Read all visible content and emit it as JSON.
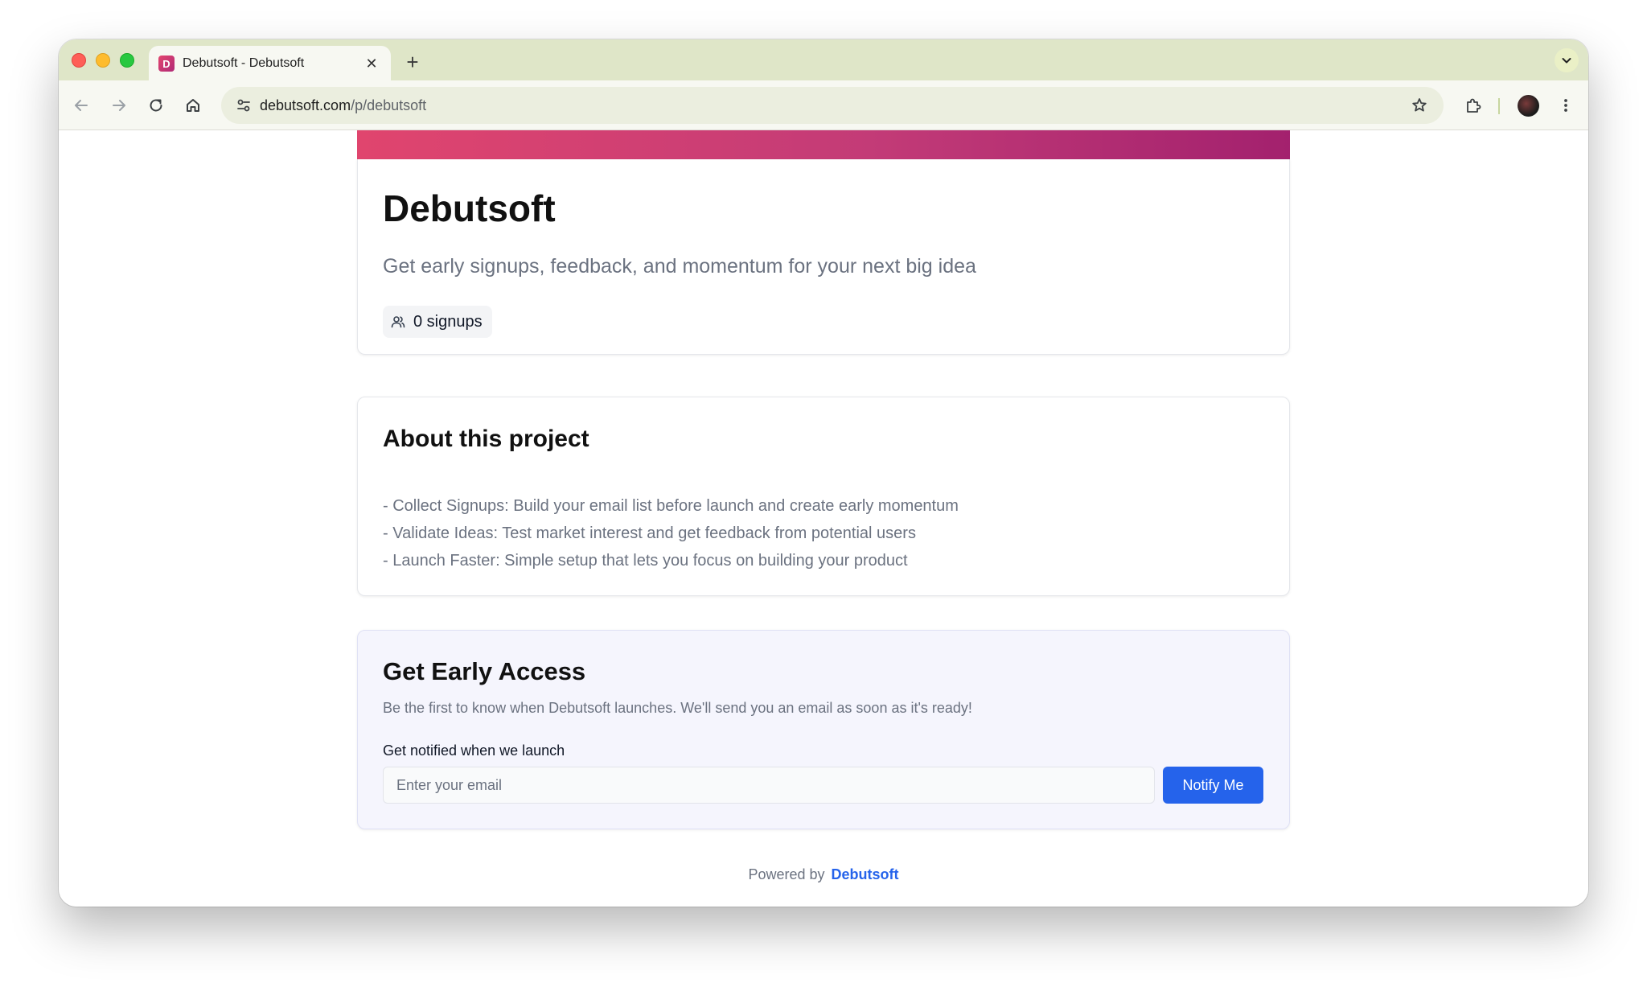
{
  "browser": {
    "tab_title": "Debutsoft - Debutsoft",
    "favicon_letter": "D",
    "url_host": "debutsoft.com",
    "url_path": "/p/debutsoft"
  },
  "hero": {
    "title": "Debutsoft",
    "subtitle": "Get early signups, feedback, and momentum for your next big idea",
    "signups_label": "0 signups"
  },
  "about": {
    "title": "About this project",
    "items": [
      "- Collect Signups: Build your email list before launch and create early momentum",
      "- Validate Ideas: Test market interest and get feedback from potential users",
      "- Launch Faster: Simple setup that lets you focus on building your product"
    ]
  },
  "access": {
    "title": "Get Early Access",
    "description": "Be the first to know when Debutsoft launches. We'll send you an email as soon as it's ready!",
    "field_label": "Get notified when we launch",
    "email_placeholder": "Enter your email",
    "button_label": "Notify Me"
  },
  "footer": {
    "powered_by": "Powered by",
    "brand": "Debutsoft"
  },
  "colors": {
    "accent": "#2563eb",
    "banner_start": "#e0456e",
    "banner_end": "#a3216e"
  }
}
